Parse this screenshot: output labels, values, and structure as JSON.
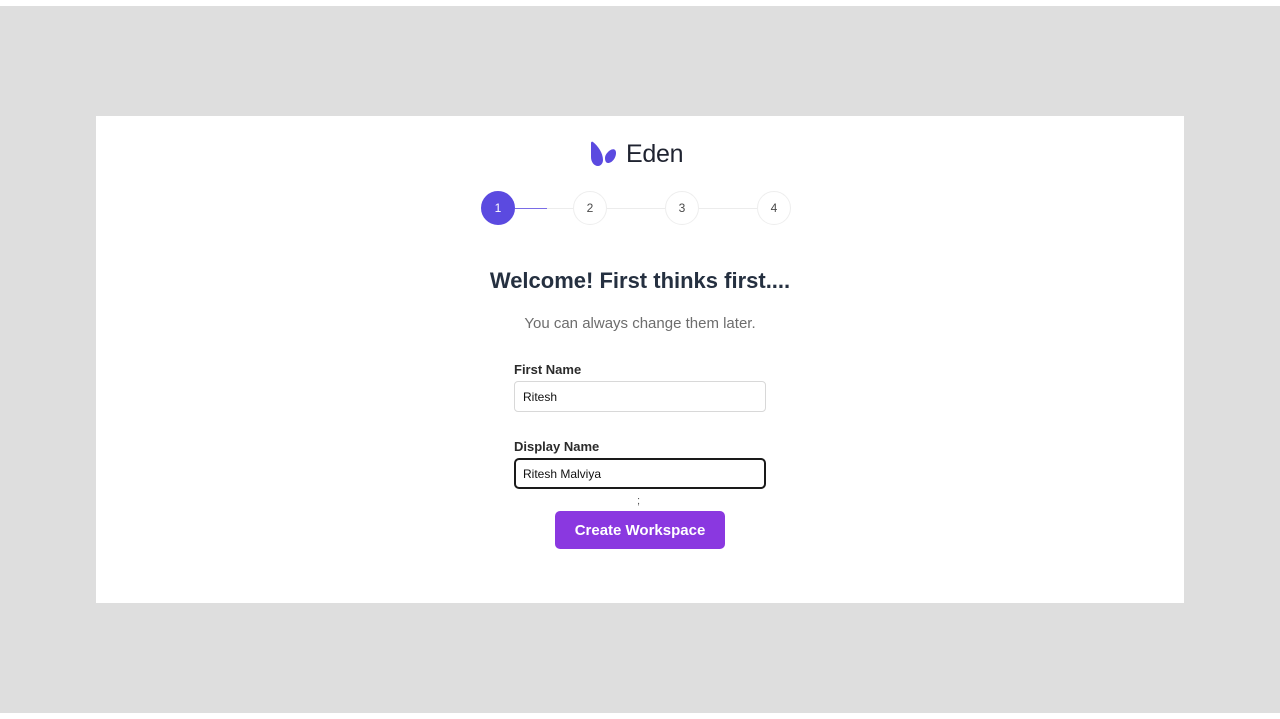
{
  "brand": {
    "name": "Eden",
    "logo_icon": "eden-leaf-icon",
    "logo_color": "#5b4ae0"
  },
  "stepper": {
    "steps": [
      "1",
      "2",
      "3",
      "4"
    ],
    "active_step": 1,
    "active_color": "#5b4ae0"
  },
  "onboarding": {
    "heading": "Welcome! First thinks first....",
    "subtitle": "You can always change them later."
  },
  "form": {
    "first_name": {
      "label": "First Name",
      "value": "Ritesh"
    },
    "display_name": {
      "label": "Display Name",
      "value": "Ritesh Malviya"
    },
    "submit_label": "Create Workspace",
    "submit_color": "#8a38e0"
  }
}
